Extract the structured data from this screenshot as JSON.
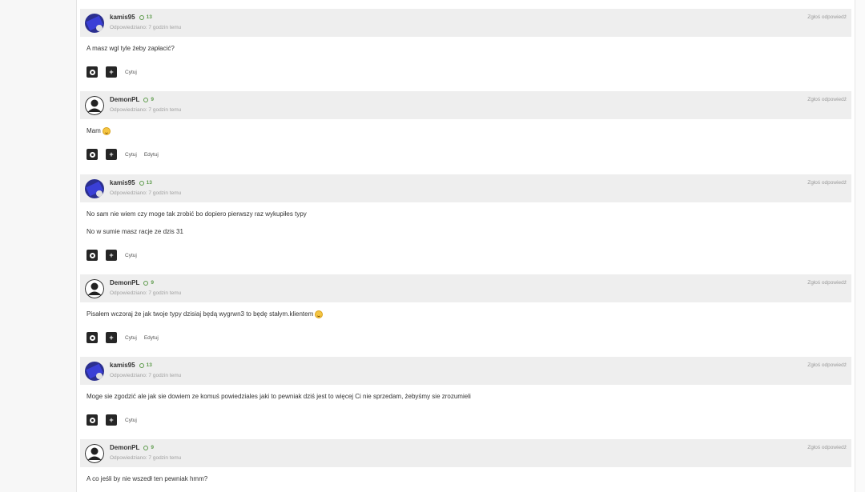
{
  "posts": [
    {
      "author": "kamis95",
      "reputation": "13",
      "avatar": "user-avatar-image",
      "timestamp": "Odpowiedziano: 7 godzin temu",
      "report": "Zgłoś odpowiedź",
      "lines": [
        "A masz wgl tyle żeby zapłacić?"
      ],
      "actions": [
        "Cytuj"
      ]
    },
    {
      "author": "DemonPL",
      "reputation": "9",
      "avatar": "default-avatar",
      "timestamp": "Odpowiedziano: 7 godzin temu",
      "report": "Zgłoś odpowiedź",
      "lines": [
        "Mam"
      ],
      "actions": [
        "Cytuj",
        "Edytuj"
      ]
    },
    {
      "author": "kamis95",
      "reputation": "13",
      "avatar": "user-avatar-image",
      "timestamp": "Odpowiedziano: 7 godzin temu",
      "report": "Zgłoś odpowiedź",
      "lines": [
        "No sam nie wiem czy moge tak zrobić bo dopiero pierwszy raz wykupiłes typy",
        "No w sumie masz racje ze dzis 31"
      ],
      "actions": [
        "Cytuj"
      ]
    },
    {
      "author": "DemonPL",
      "reputation": "9",
      "avatar": "default-avatar",
      "timestamp": "Odpowiedziano: 7 godzin temu",
      "report": "Zgłoś odpowiedź",
      "lines": [
        "Pisałem wczoraj że jak twoje typy dzisiaj będą wygrwn3 to będę stałym.klientem"
      ],
      "actions": [
        "Cytuj",
        "Edytuj"
      ]
    },
    {
      "author": "kamis95",
      "reputation": "13",
      "avatar": "user-avatar-image",
      "timestamp": "Odpowiedziano: 7 godzin temu",
      "report": "Zgłoś odpowiedź",
      "lines": [
        "Moge sie zgodzić ale jak sie dowiem ze komuś powiedziales jaki to pewniak dziś jest to więcej Ci nie sprzedam, żebyśmy sie zrozumieli"
      ],
      "actions": [
        "Cytuj"
      ]
    },
    {
      "author": "DemonPL",
      "reputation": "9",
      "avatar": "default-avatar",
      "timestamp": "Odpowiedziano: 7 godzin temu",
      "report": "Zgłoś odpowiedź",
      "lines": [
        "A co jeśli by nie wszedł ten pewniak hmm?"
      ],
      "actions": []
    }
  ],
  "icons": {
    "settings": "settings-icon",
    "plus": "plus-icon",
    "emoji": "smiley-emoji-icon"
  },
  "colors": {
    "header_bg": "#eeeeee",
    "reputation": "#5c9a4a",
    "action_button": "#262626"
  }
}
